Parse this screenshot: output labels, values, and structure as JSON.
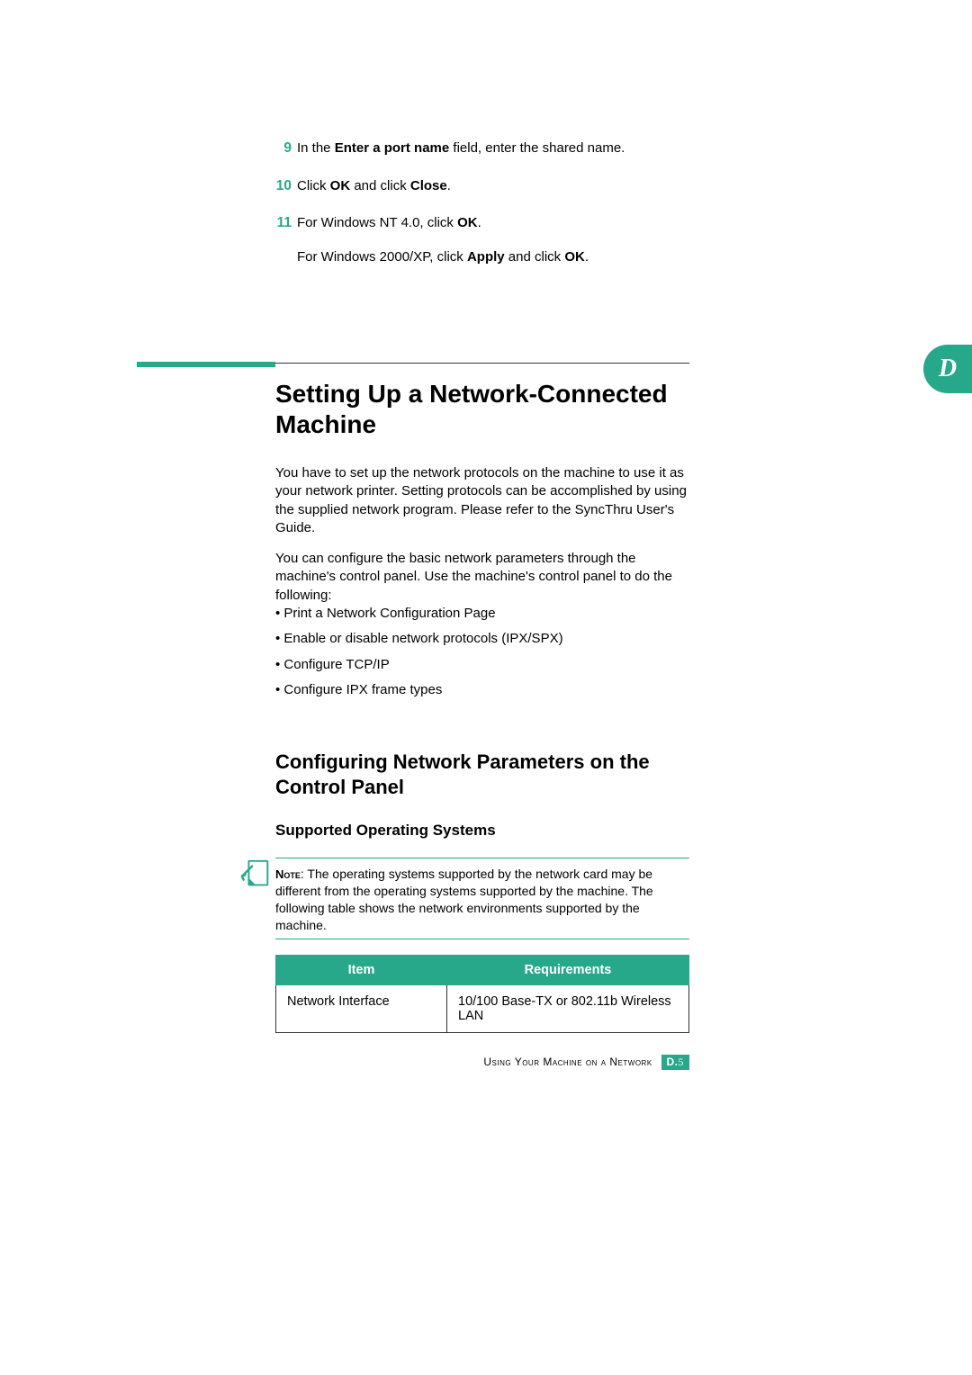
{
  "section_tab": "D",
  "steps": [
    {
      "num": "9",
      "parts": [
        "In the ",
        {
          "bold": true,
          "text": "Enter a port name"
        },
        " field, enter the shared name."
      ]
    },
    {
      "num": "10",
      "parts": [
        "Click ",
        {
          "bold": true,
          "text": "OK"
        },
        " and click ",
        {
          "bold": true,
          "text": "Close"
        },
        "."
      ]
    },
    {
      "num": "11",
      "parts": [
        "For Windows NT 4.0, click ",
        {
          "bold": true,
          "text": "OK"
        },
        "."
      ],
      "line2_parts": [
        "For Windows 2000/XP, click ",
        {
          "bold": true,
          "text": "Apply"
        },
        " and click ",
        {
          "bold": true,
          "text": "OK"
        },
        "."
      ]
    }
  ],
  "h1": "Setting Up a Network-Connected Machine",
  "body1": "You have to set up the network protocols on the machine to use it as your network printer. Setting protocols can be accomplished by using the supplied network program. Please refer to the SyncThru User's Guide.",
  "body2": "You can configure the basic network parameters through the machine's control panel. Use the machine's control panel to do the following:",
  "bullets": [
    "• Print a Network Configuration Page",
    "• Enable or disable network protocols (IPX/SPX)",
    "• Configure TCP/IP",
    "• Configure IPX frame types"
  ],
  "h2": "Configuring Network Parameters on the Control Panel",
  "h3": "Supported Operating Systems",
  "note_label": "Note",
  "note_text": ": The operating systems supported by the network card may be different from the operating systems supported by the machine. The following table shows the network environments supported by the machine.",
  "table": {
    "headers": [
      "Item",
      "Requirements"
    ],
    "rows": [
      [
        "Network Interface",
        "10/100 Base-TX or 802.11b Wireless LAN"
      ]
    ]
  },
  "footer_text": "Using Your Machine on a Network",
  "footer_badge_prefix": "D.",
  "footer_badge_page": "5"
}
